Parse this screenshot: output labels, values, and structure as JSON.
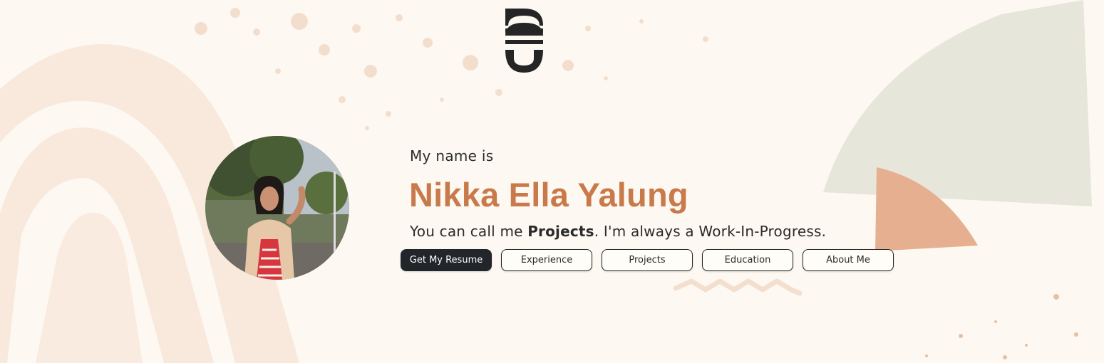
{
  "hero": {
    "intro": "My name is",
    "name": "Nikka Ella Yalung",
    "tagline_prefix": "You can call me ",
    "tagline_highlight": "Projects",
    "tagline_suffix": ". I'm always a Work-In-Progress."
  },
  "buttons": [
    {
      "label": "Get My Resume"
    },
    {
      "label": "Experience"
    },
    {
      "label": "Projects"
    },
    {
      "label": "Education"
    },
    {
      "label": "About Me"
    }
  ],
  "colors": {
    "background": "#fdf9f2",
    "accent": "#c97a4a",
    "primary_button": "#22252a",
    "sage_shape": "#e6e6da",
    "peach_shape": "#f6e3d5",
    "terracotta_shape": "#e6b090"
  },
  "icons": {
    "logo": "site-monogram-logo",
    "avatar": "profile-photo"
  }
}
